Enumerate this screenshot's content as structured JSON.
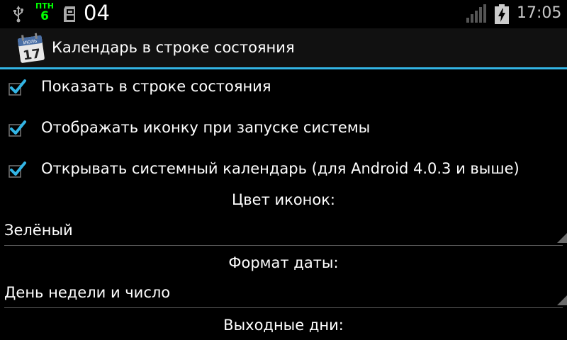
{
  "status_bar": {
    "day_of_week": "ПТН",
    "day_number": "6",
    "date": "04",
    "time": "17:05",
    "icons": [
      "usb-icon",
      "sd-card-icon",
      "signal-icon",
      "battery-charging-icon"
    ]
  },
  "title_bar": {
    "title": "Календарь в строке состояния",
    "icon": "calendar-icon",
    "icon_text": {
      "month": "ИЮЛЬ",
      "day": "17"
    }
  },
  "settings": {
    "checkboxes": [
      {
        "label": "Показать в строке состояния",
        "checked": true
      },
      {
        "label": "Отображать иконку при запуске системы",
        "checked": true
      },
      {
        "label": "Открывать системный календарь (для Android 4.0.3 и выше)",
        "checked": true
      }
    ],
    "icon_color": {
      "label": "Цвет иконок:",
      "value": "Зелёный"
    },
    "date_format": {
      "label": "Формат даты:",
      "value": "День недели и число"
    },
    "weekends": {
      "label": "Выходные дни:"
    }
  },
  "colors": {
    "accent": "#33b5e5",
    "status_day": "#00ff00",
    "background": "#000000"
  }
}
